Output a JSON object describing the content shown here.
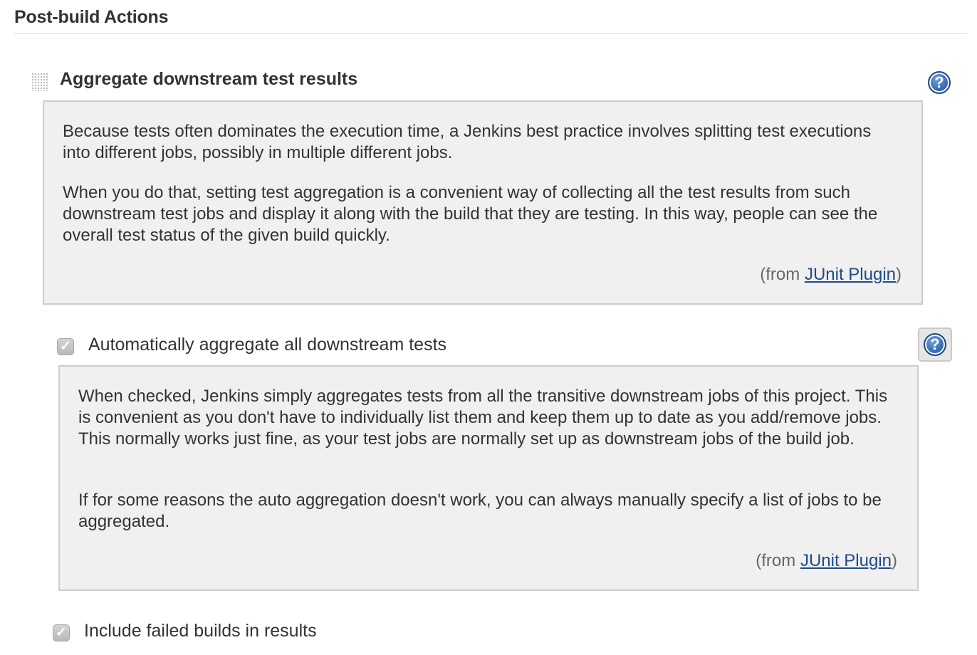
{
  "section": {
    "title": "Post-build Actions"
  },
  "action": {
    "title": "Aggregate downstream test results",
    "help_icon": "question-mark-icon",
    "help": {
      "paragraphs": [
        "Because tests often dominates the execution time, a Jenkins best practice involves splitting test executions into different jobs, possibly in multiple different jobs.",
        "When you do that, setting test aggregation is a convenient way of collecting all the test results from such downstream test jobs and display it along with the build that they are testing. In this way, people can see the overall test status of the given build quickly."
      ],
      "from_prefix": "(from ",
      "from_link": "JUnit Plugin",
      "from_suffix": ")"
    }
  },
  "auto_aggregate": {
    "label": "Automatically aggregate all downstream tests",
    "checked": true,
    "check_glyph": "✓",
    "help_icon": "question-mark-icon",
    "help": {
      "paragraphs": [
        "When checked, Jenkins simply aggregates tests from all the transitive downstream jobs of this project. This is convenient as you don't have to individually list them and keep them up to date as you add/remove jobs. This normally works just fine, as your test jobs are normally set up as downstream jobs of the build job.",
        "If for some reasons the auto aggregation doesn't work, you can always manually specify a list of jobs to be aggregated."
      ],
      "from_prefix": "(from ",
      "from_link": "JUnit Plugin",
      "from_suffix": ")"
    }
  },
  "include_failed": {
    "label": "Include failed builds in results",
    "checked": true,
    "check_glyph": "✓"
  },
  "colors": {
    "link": "#204a87",
    "help_bg": "#f0f0f0",
    "help_border": "#cccccc",
    "icon_blue": "#3a6fb5"
  }
}
